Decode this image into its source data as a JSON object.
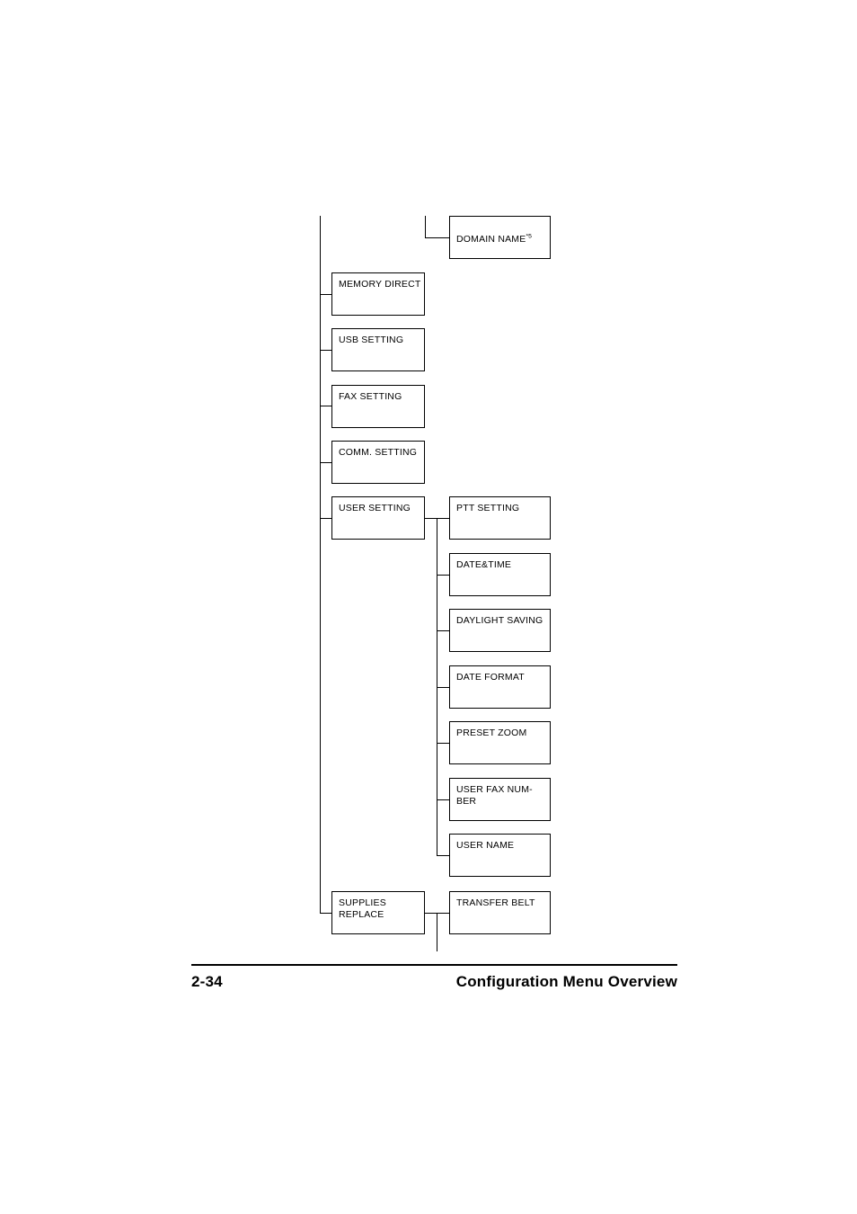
{
  "document": {
    "footer": {
      "page_number": "2-34",
      "section_title": "Configuration Menu Overview"
    }
  },
  "diagram": {
    "type": "menu-tree",
    "level1_nodes": [
      {
        "label": "MEMORY DIRECT"
      },
      {
        "label": "USB SETTING"
      },
      {
        "label": "FAX SETTING"
      },
      {
        "label": "COMM. SETTING"
      },
      {
        "label": "USER SETTING"
      },
      {
        "label": "SUPPLIES\nREPLACE"
      }
    ],
    "level2_nodes": {
      "top_orphan": {
        "label": "DOMAIN NAME",
        "superscript": "*5"
      },
      "user_setting_children": [
        {
          "label": "PTT SETTING"
        },
        {
          "label": "DATE&TIME"
        },
        {
          "label": "DAYLIGHT SAVING"
        },
        {
          "label": "DATE FORMAT"
        },
        {
          "label": "PRESET ZOOM"
        },
        {
          "label": "USER FAX NUM-\nBER"
        },
        {
          "label": "USER NAME"
        }
      ],
      "supplies_replace_children": [
        {
          "label": "TRANSFER BELT"
        }
      ]
    }
  }
}
